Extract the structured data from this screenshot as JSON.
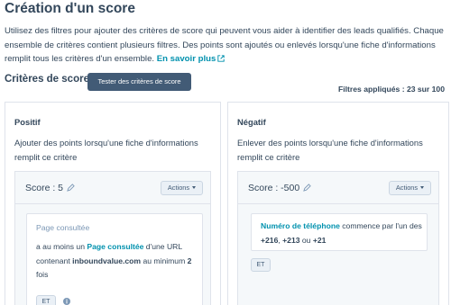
{
  "page": {
    "title": "Création d'un score",
    "intro_text": "Utilisez des filtres pour ajouter des critères de score qui peuvent vous aider à identifier des leads qualifiés. Chaque ensemble de critères contient plusieurs filtres. Des points sont ajoutés ou enlevés lorsqu'une fiche d'informations remplit tous les critères d'un ensemble.",
    "learn_more": "En savoir plus"
  },
  "criteria": {
    "title": "Critères de score",
    "test_button": "Tester des critères de score",
    "applied": "Filtres appliqués : 23 sur 100"
  },
  "positive": {
    "heading": "Positif",
    "description": "Ajouter des points lorsqu'une fiche d'informations remplit ce critère",
    "score_label": "Score : 5",
    "actions": "Actions",
    "filter": {
      "title": "Page consultée",
      "t1": "a au moins un ",
      "t2": "Page consultée",
      "t3": " d'une URL contenant ",
      "t4": "inboundvalue.com",
      "t5": "  au minimum ",
      "t6": "2",
      "t7": " fois"
    },
    "and_button": "ET"
  },
  "negative": {
    "heading": "Négatif",
    "description": "Enlever des points lorsqu'une fiche d'informations remplit ce critère",
    "score_label": "Score : -500",
    "actions": "Actions",
    "filter": {
      "t1": "Numéro de téléphone",
      "t2": " commence par l'un des ",
      "t3": "+216",
      "t4": ", ",
      "t5": "+213",
      "t6": " ou ",
      "t7": "+21"
    },
    "and_button": "ET"
  },
  "icons": {
    "external": "external-link-icon",
    "pencil": "pencil-icon",
    "caret": "caret-down-icon",
    "info": "info-icon"
  },
  "colors": {
    "link": "#0091ae",
    "primary_button": "#425b76",
    "text": "#33475b",
    "muted": "#7c98b6"
  }
}
